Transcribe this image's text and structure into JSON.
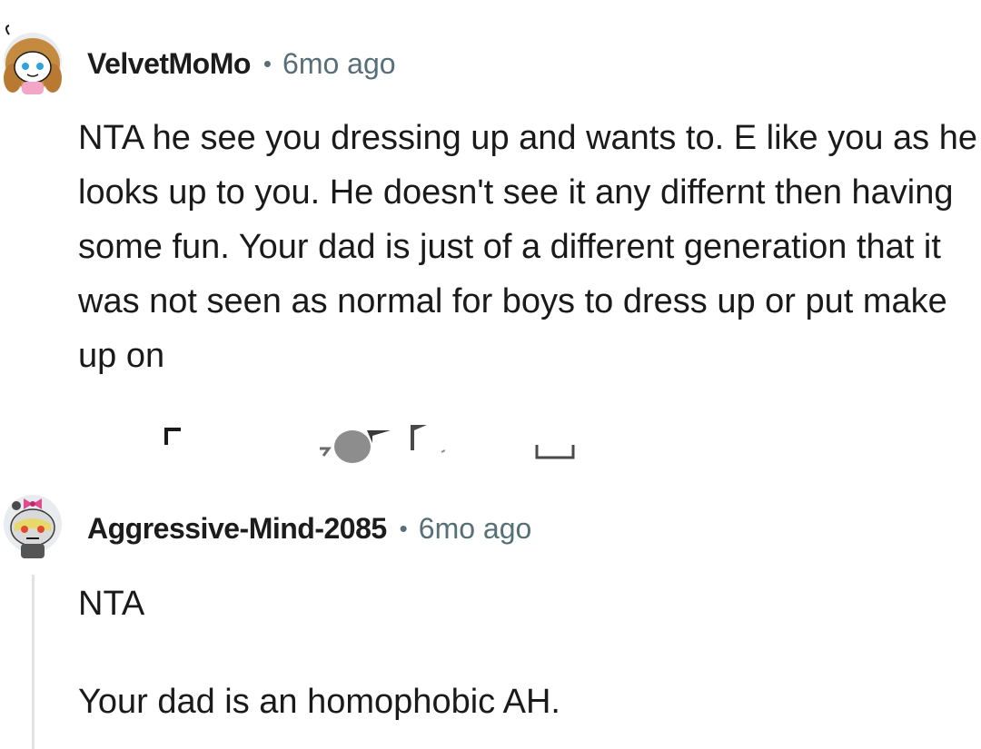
{
  "comments": [
    {
      "username": "VelvetMoMo",
      "separator": "•",
      "time": "6mo ago",
      "body": "NTA he see you dressing up and wants to. E like you as he looks up to you. He doesn't see it any differnt then having some fun. Your dad is just of a different generation that it was not seen as normal for boys to dress up or put make up on"
    },
    {
      "username": "Aggressive-Mind-2085",
      "separator": "•",
      "time": "6mo ago",
      "body_paragraphs": [
        "NTA",
        "Your dad is an homophobic AH."
      ]
    }
  ],
  "colors": {
    "meta_gray": "#576f76",
    "text": "#1a1a1b",
    "thread_line": "#dfe3e5"
  },
  "icons": [
    "avatar-snoo-girl",
    "avatar-snoo-raccoon",
    "upvote-icon",
    "downvote-icon",
    "reply-icon",
    "share-icon",
    "more-icon"
  ]
}
